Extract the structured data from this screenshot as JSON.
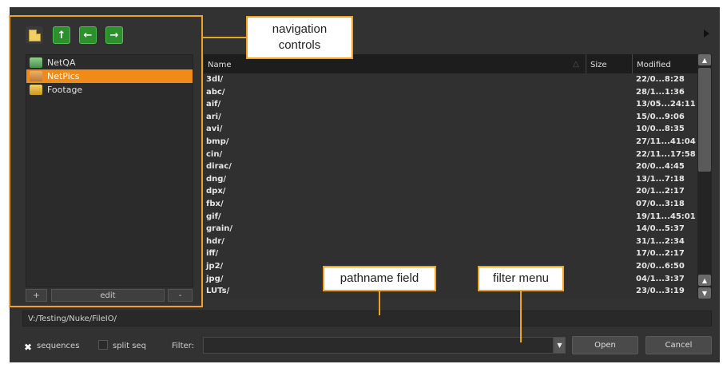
{
  "navigation": {
    "buttons": [
      {
        "name": "favorite-add",
        "glyph": ""
      },
      {
        "name": "up",
        "glyph": "↑"
      },
      {
        "name": "back",
        "glyph": "←"
      },
      {
        "name": "forward",
        "glyph": "→"
      }
    ]
  },
  "favorites": {
    "items": [
      {
        "label": "NetQA",
        "selected": false
      },
      {
        "label": "NetPics",
        "selected": true
      },
      {
        "label": "Footage",
        "selected": false
      }
    ],
    "add_label": "+",
    "edit_label": "edit",
    "remove_label": "-"
  },
  "file_list": {
    "columns": {
      "name": "Name",
      "size": "Size",
      "modified": "Modified"
    },
    "rows": [
      {
        "name": "3dl/",
        "modified": "22/0...8:28"
      },
      {
        "name": "abc/",
        "modified": "28/1...1:36"
      },
      {
        "name": "aif/",
        "modified": "13/05...24:11"
      },
      {
        "name": "ari/",
        "modified": "15/0...9:06"
      },
      {
        "name": "avi/",
        "modified": "10/0...8:35"
      },
      {
        "name": "bmp/",
        "modified": "27/11...41:04"
      },
      {
        "name": "cin/",
        "modified": "22/11...17:58"
      },
      {
        "name": "dirac/",
        "modified": "20/0...4:45"
      },
      {
        "name": "dng/",
        "modified": "13/1...7:18"
      },
      {
        "name": "dpx/",
        "modified": "20/1...2:17"
      },
      {
        "name": "fbx/",
        "modified": "07/0...3:18"
      },
      {
        "name": "gif/",
        "modified": "19/11...45:01"
      },
      {
        "name": "grain/",
        "modified": "14/0...5:37"
      },
      {
        "name": "hdr/",
        "modified": "31/1...2:34"
      },
      {
        "name": "iff/",
        "modified": "17/0...2:17"
      },
      {
        "name": "jp2/",
        "modified": "20/0...6:50"
      },
      {
        "name": "jpg/",
        "modified": "04/1...3:37"
      },
      {
        "name": "LUTs/",
        "modified": "23/0...3:19"
      }
    ]
  },
  "path_field": {
    "value": "V:/Testing/Nuke/FileIO/"
  },
  "options": {
    "sequences_label": "sequences",
    "sequences_checked": true,
    "split_seq_label": "split seq",
    "split_seq_checked": false,
    "filter_label": "Filter:",
    "filter_value": ""
  },
  "actions": {
    "open_label": "Open",
    "cancel_label": "Cancel"
  },
  "callouts": {
    "navigation_line1": "navigation",
    "navigation_line2": "controls",
    "pathname": "pathname field",
    "filter": "filter menu"
  },
  "colors": {
    "accent": "#f0a322",
    "selection": "#f08a18",
    "background": "#323232"
  }
}
